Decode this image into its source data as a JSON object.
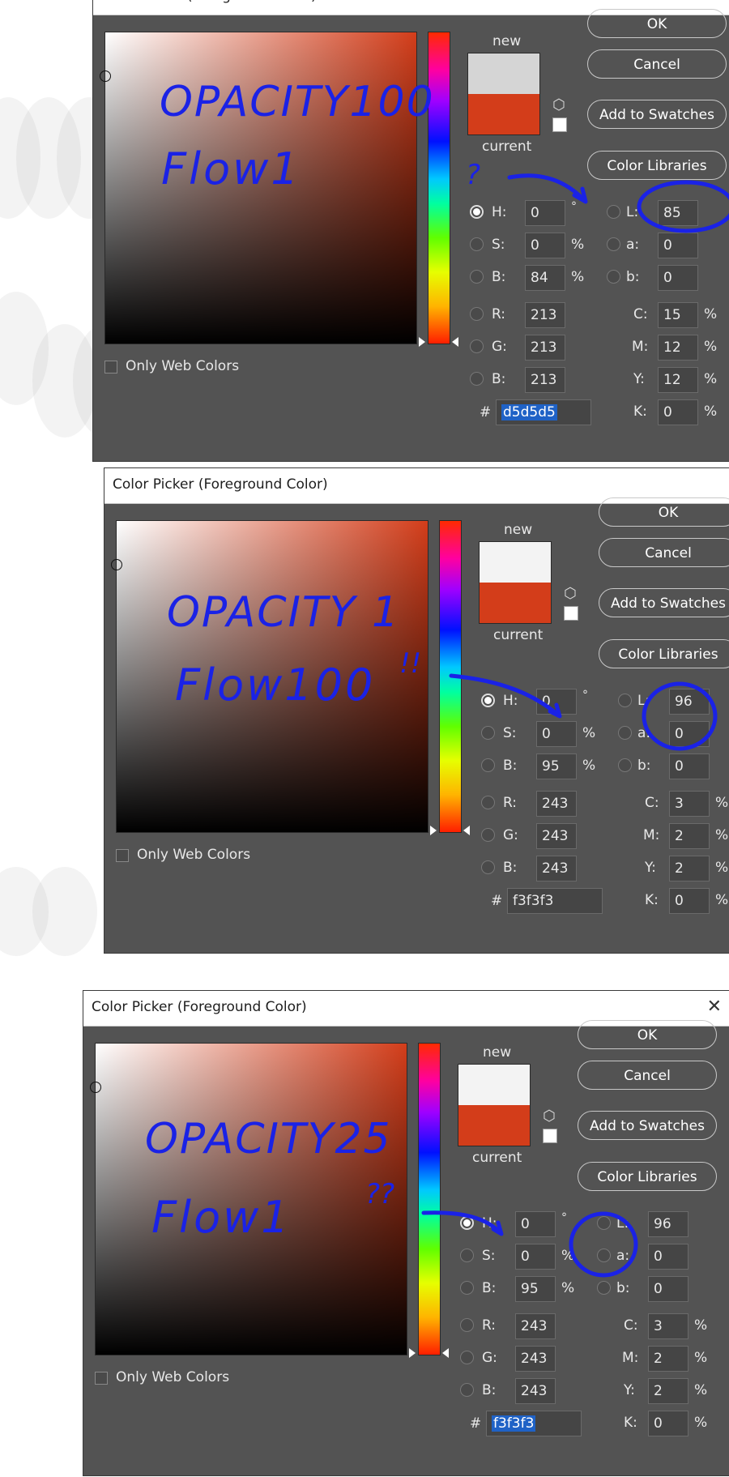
{
  "dialogs": [
    {
      "title": "Color Picker (Foreground Color)",
      "close_glyph": "✕",
      "new_label": "new",
      "current_label": "current",
      "new_color": "#d5d5d5",
      "buttons": {
        "ok": "OK",
        "cancel": "Cancel",
        "add": "Add to Swatches",
        "libraries": "Color Libraries"
      },
      "hsb": {
        "h": "0",
        "h_unit": "°",
        "s": "0",
        "s_unit": "%",
        "b": "84",
        "b_unit": "%"
      },
      "rgb": {
        "r": "213",
        "g": "213",
        "b": "213"
      },
      "lab": {
        "l": "85",
        "a": "0",
        "b": "0"
      },
      "cmyk": {
        "c": "15",
        "m": "12",
        "y": "12",
        "k": "0",
        "unit": "%"
      },
      "hex": "d5d5d5",
      "hex_selected": true,
      "web_colors_label": "Only Web Colors",
      "annotation": {
        "line1": "OPACITY100",
        "line2": "Flow1",
        "mark": "?"
      }
    },
    {
      "title": "Color Picker (Foreground Color)",
      "close_glyph": "✕",
      "new_label": "new",
      "current_label": "current",
      "new_color": "#f3f3f3",
      "buttons": {
        "ok": "OK",
        "cancel": "Cancel",
        "add": "Add to Swatches",
        "libraries": "Color Libraries"
      },
      "hsb": {
        "h": "0",
        "h_unit": "°",
        "s": "0",
        "s_unit": "%",
        "b": "95",
        "b_unit": "%"
      },
      "rgb": {
        "r": "243",
        "g": "243",
        "b": "243"
      },
      "lab": {
        "l": "96",
        "a": "0",
        "b": "0"
      },
      "cmyk": {
        "c": "3",
        "m": "2",
        "y": "2",
        "k": "0",
        "unit": "%"
      },
      "hex": "f3f3f3",
      "hex_selected": false,
      "web_colors_label": "Only Web Colors",
      "annotation": {
        "line1": "OPACITY 1",
        "line2": "Flow100",
        "mark": "!!"
      }
    },
    {
      "title": "Color Picker (Foreground Color)",
      "close_glyph": "✕",
      "new_label": "new",
      "current_label": "current",
      "new_color": "#f3f3f3",
      "buttons": {
        "ok": "OK",
        "cancel": "Cancel",
        "add": "Add to Swatches",
        "libraries": "Color Libraries"
      },
      "hsb": {
        "h": "0",
        "h_unit": "°",
        "s": "0",
        "s_unit": "%",
        "b": "95",
        "b_unit": "%"
      },
      "rgb": {
        "r": "243",
        "g": "243",
        "b": "243"
      },
      "lab": {
        "l": "96",
        "a": "0",
        "b": "0"
      },
      "cmyk": {
        "c": "3",
        "m": "2",
        "y": "2",
        "k": "0",
        "unit": "%"
      },
      "hex": "f3f3f3",
      "hex_selected": true,
      "web_colors_label": "Only Web Colors",
      "annotation": {
        "line1": "OPACITY25",
        "line2": "Flow1",
        "mark": "??"
      }
    }
  ],
  "labels": {
    "h": "H:",
    "s": "S:",
    "b": "B:",
    "r": "R:",
    "g": "G:",
    "l": "L:",
    "a": "a:",
    "lab_b": "b:",
    "c": "C:",
    "m": "M:",
    "y": "Y:",
    "k": "K:",
    "hash": "#"
  },
  "colors": {
    "dialog_bg": "#535353",
    "current_color": "#d33d1a",
    "annotation_ink": "#1a22e6"
  }
}
